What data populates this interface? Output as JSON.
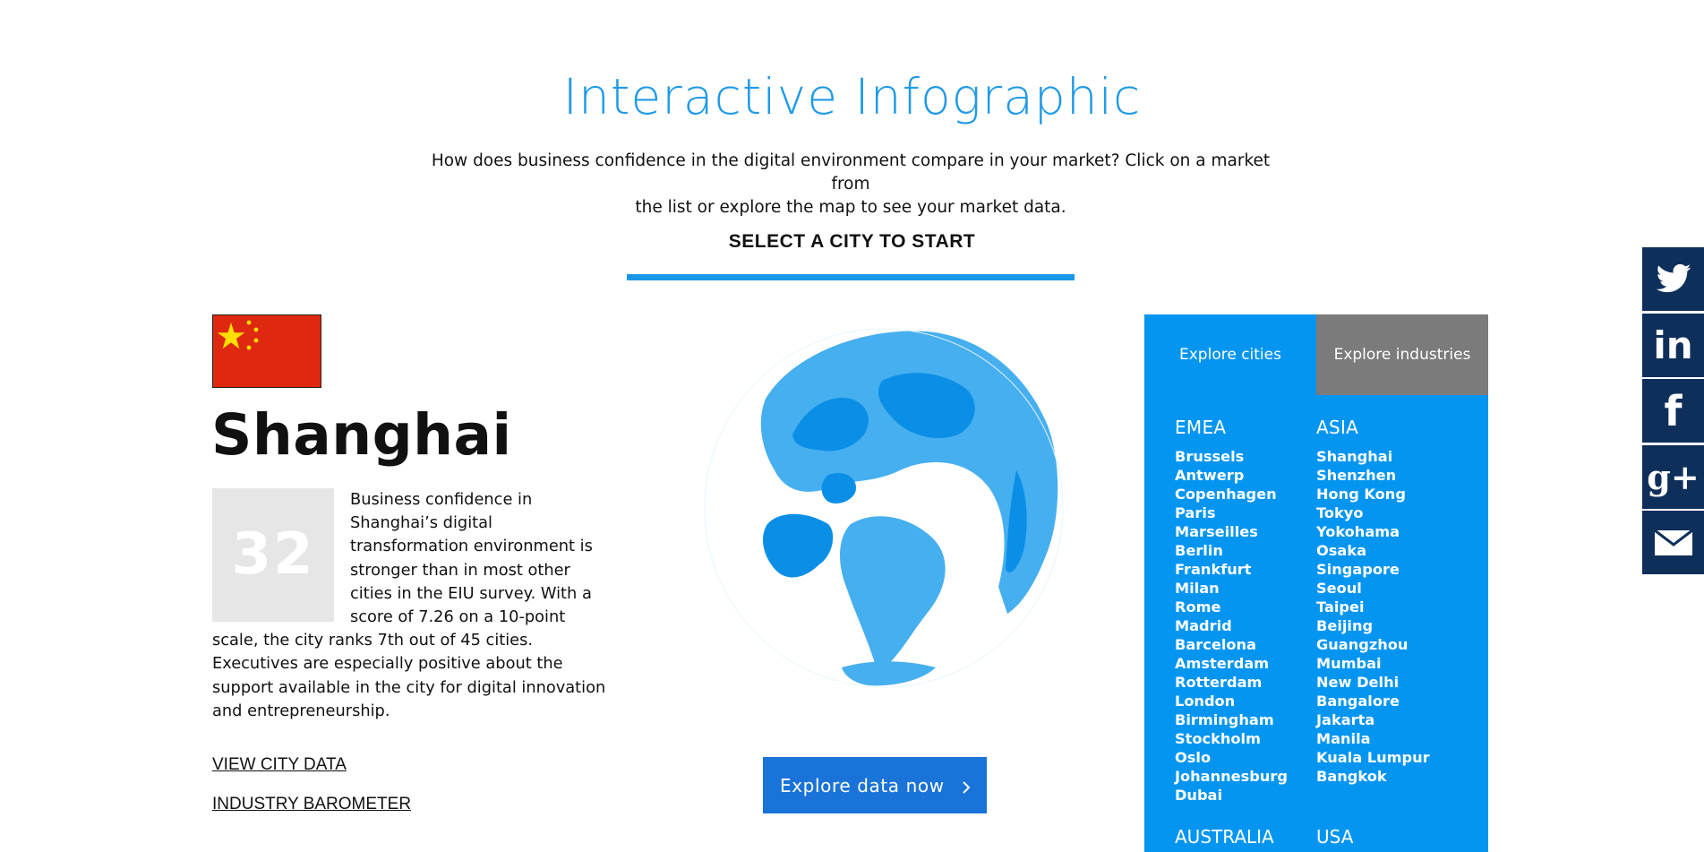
{
  "header": {
    "title": "Interactive Infographic",
    "intro_line1": "How does business confidence in the digital environment compare in your market? Click on a market from",
    "intro_line2": "the list or explore the map to see your market data.",
    "select_prompt": "SELECT A CITY TO START"
  },
  "city": {
    "name": "Shanghai",
    "flag": "china-flag",
    "score": "32",
    "description": "Business confidence in Shanghai’s digital transformation environment is stronger than in most other cities in the EIU survey. With a score of 7.26 on a 10-point scale, the city ranks 7th out of 45 cities. Executives are especially positive about the support available in the city for digital innovation and entrepreneurship.",
    "link_city_data": "VIEW CITY DATA",
    "link_barometer": "INDUSTRY BAROMETER"
  },
  "globe": {
    "icon": "globe-map",
    "cta": "Explore data now"
  },
  "panel": {
    "tabs": [
      "Explore cities",
      "Explore industries"
    ],
    "regions": [
      {
        "name": "EMEA",
        "cities": [
          "Brussels",
          "Antwerp",
          "Copenhagen",
          "Paris",
          "Marseilles",
          "Berlin",
          "Frankfurt",
          "Milan",
          "Rome",
          "Madrid",
          "Barcelona",
          "Amsterdam",
          "Rotterdam",
          "London",
          "Birmingham",
          "Stockholm",
          "Oslo",
          "Johannesburg",
          "Dubai"
        ]
      },
      {
        "name": "ASIA",
        "cities": [
          "Shanghai",
          "Shenzhen",
          "Hong Kong",
          "Tokyo",
          "Yokohama",
          "Osaka",
          "Singapore",
          "Seoul",
          "Taipei",
          "Beijing",
          "Guangzhou",
          "Mumbai",
          "New Delhi",
          "Bangalore",
          "Jakarta",
          "Manila",
          "Kuala Lumpur",
          "Bangkok"
        ]
      }
    ],
    "more_regions": [
      "AUSTRALIA",
      "USA"
    ]
  },
  "social": {
    "icons": [
      "twitter-icon",
      "linkedin-icon",
      "facebook-icon",
      "google-plus-icon",
      "email-icon"
    ],
    "labels": {
      "linkedin": "in",
      "facebook": "f",
      "google": "g+"
    }
  },
  "colors": {
    "accent": "#1b97e8",
    "panel": "#0495f1",
    "tab_inactive": "#7b7b7b",
    "cta": "#1a73d8",
    "social": "#0f2f5b",
    "score_box": "#e6e6e6"
  }
}
